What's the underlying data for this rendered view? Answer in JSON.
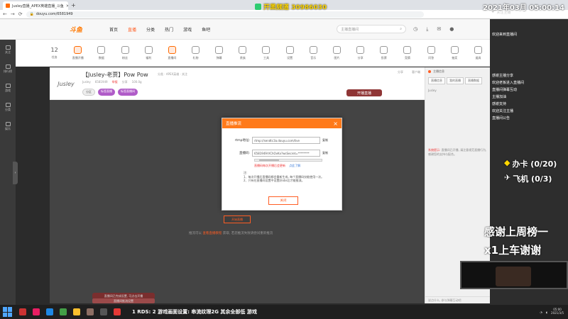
{
  "browser": {
    "tab_title": "Jusley直播_APEX英雄直播_斗鱼",
    "url": "douyu.com/6581949",
    "new_tab": "+",
    "close": "×"
  },
  "overlay": {
    "stream_channel": "开黑频道 30986030",
    "clock": "2021年03月 05:00:14"
  },
  "site_header": {
    "logo": "斗鱼",
    "nav": [
      "首页",
      "直播",
      "分类",
      "热门",
      "游戏",
      "鱼吧"
    ],
    "active_nav": "直播",
    "search_placeholder": "主播直播间",
    "search_icon": "search-icon"
  },
  "left_sidebar": {
    "items": [
      "关注",
      "排行榜",
      "游戏",
      "分类",
      "娱乐"
    ]
  },
  "tools_row": {
    "level_number": "12",
    "items": [
      "任务",
      "直播开播",
      "数据",
      "粉丝",
      "福利",
      "直播间",
      "礼物",
      "弹幕",
      "贵族",
      "工具",
      "设置",
      "音乐",
      "图片",
      "分享",
      "投票",
      "竞猜",
      "问答",
      "抽奖",
      "道具",
      "录播",
      "更多"
    ]
  },
  "room": {
    "avatar_text": "Jusley",
    "title": "【Jusley-老贾】Pow Pow",
    "meta": "分类 · APEX英雄 · 关注",
    "sub": [
      "Jusley",
      "6581949",
      "举报",
      "分享",
      "100.0g"
    ],
    "tags": [
      "分区",
      "标签直播",
      "标签直播间"
    ],
    "actions": [
      "分享",
      "客户端"
    ],
    "open_live_button": "开播直播"
  },
  "player": {
    "start_button": "开始直播",
    "hint_prefix": "推流可以",
    "hint_link": "查看直播教程",
    "hint_suffix": "获取, 若您推流失败请尝试重新推流",
    "note1": "直播间已完成设置, 可点击开播",
    "note2": "直播间推流设置"
  },
  "right_panel": {
    "head": "主播信息",
    "tabs": [
      "直播信息",
      "我的直播",
      "直播数据"
    ],
    "user": "Jusley",
    "sys_label": "系统提示:",
    "sys_text": "直播间已开播, 请注意规范直播行为, 感谢您的支持与配合。",
    "send_hint": "说点什么, 参与弹幕互动吧"
  },
  "modal": {
    "title": "直播推流",
    "rtmp_label": "rtmp地址:",
    "rtmp_value": "rtmp://sendtc3a.douyu.com/live",
    "key_label": "直播码:",
    "key_value": "6581949rVChOvKx?wsSecret=********",
    "copy": "复制",
    "warning": "直播码每次开播后会更新",
    "warning_link": "点此了解",
    "note_title": "注:",
    "note1": "1、每次开播后直播码都会重新生成, 每个直播码仅能使用一次。",
    "note2": "2、只有在直播间设置中设置好obs后才能推流。",
    "close_button": "关闭"
  },
  "stream_chat": {
    "top": "关注主播",
    "lines": [
      "欢迎来到直播间",
      "感谢主播分享",
      "欢迎老板进入直播间",
      "直播间弹幕互动",
      "主播加油",
      "感谢支持",
      "欢迎关注主播",
      "直播间公告"
    ],
    "gift1": "办卡 (0/20)",
    "gift2": "飞机 (0/3)",
    "banner1": "感谢上周榜一",
    "banner2": "x1上车谢谢"
  },
  "taskbar": {
    "text": "1 RDS: 2 游戏画面设置: 串流纹理2G 其余全部低 游戏",
    "clock_time": "05:00",
    "clock_date": "2021/3/5"
  },
  "colors": {
    "accent": "#ff5d23",
    "modal_header": "#ff7a1a",
    "overlay_gold": "#ffd700"
  }
}
